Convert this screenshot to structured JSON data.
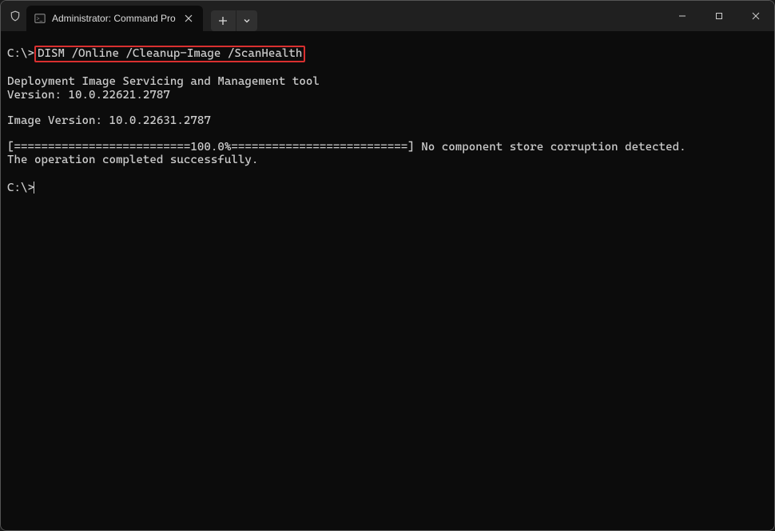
{
  "titlebar": {
    "tab_title": "Administrator: Command Pro",
    "new_tab_label": "+",
    "dropdown_label": "⌄"
  },
  "window_controls": {
    "minimize": "Minimize",
    "maximize": "Maximize",
    "close": "Close"
  },
  "terminal": {
    "prompt1_prefix": "C:\\>",
    "command": "DISM /Online /Cleanup-Image /ScanHealth",
    "blank1": "",
    "line_tool": "Deployment Image Servicing and Management tool",
    "line_version": "Version: 10.0.22621.2787",
    "blank2": "",
    "line_image_version": "Image Version: 10.0.22631.2787",
    "blank3": "",
    "line_progress": "[==========================100.0%==========================] No component store corruption detected.",
    "line_success": "The operation completed successfully.",
    "blank4": "",
    "prompt2": "C:\\>"
  }
}
